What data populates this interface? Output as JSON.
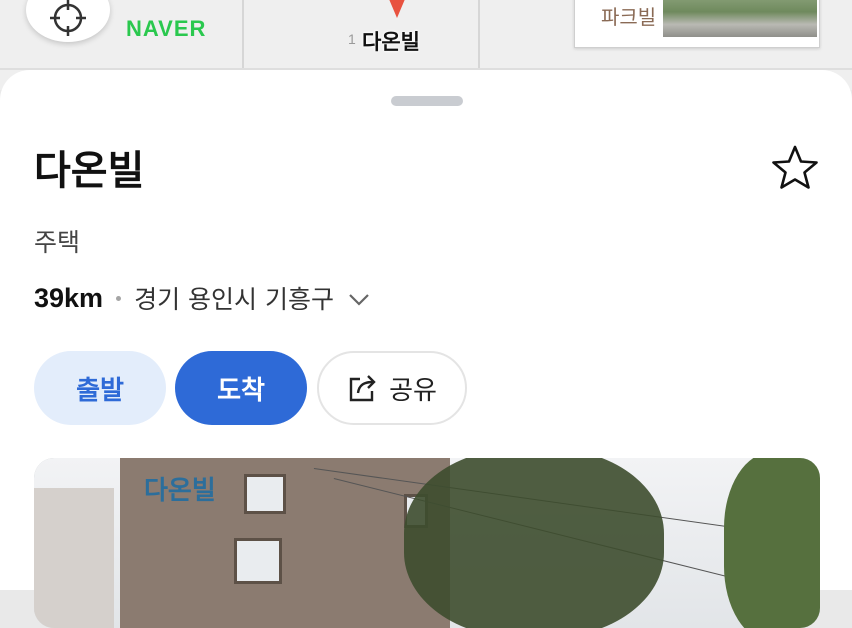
{
  "map": {
    "logo_text": "NAVER",
    "pin_label": "다온빌",
    "pin_number_partial": "1",
    "nearby_card_label": "파크빌"
  },
  "place": {
    "name": "다온빌",
    "category": "주택",
    "distance": "39km",
    "address": "경기 용인시 기흥구"
  },
  "actions": {
    "depart_label": "출발",
    "arrive_label": "도착",
    "share_label": "공유"
  },
  "photo": {
    "sign_text": "다온빌"
  },
  "colors": {
    "naver_green": "#2ac84e",
    "accent_blue": "#2e6ad7",
    "depart_bg": "#e3edfb",
    "pin_red": "#e8523f"
  },
  "icons": {
    "locate": "crosshair-icon",
    "pin": "map-pin-icon",
    "favorite": "star-outline-icon",
    "expand": "chevron-down-icon",
    "share": "share-icon"
  }
}
